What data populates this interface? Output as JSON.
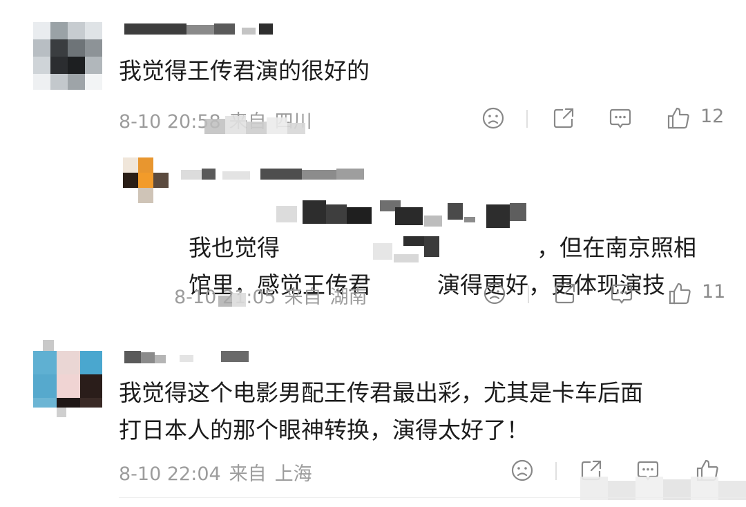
{
  "comments": [
    {
      "content": "我觉得王传君演的很好的",
      "time": "8-10 20:58",
      "from_label": "来自",
      "location": "四川",
      "likes": "12"
    },
    {
      "content_line1": "我也觉得",
      "content_line1_tail": "，但在南京照相",
      "content_line2_a": "馆里，感觉王传君",
      "content_line2_b": "演得更好，更体现演技",
      "time": "8-10 21:05",
      "from_label": "来自",
      "location": "湖南",
      "likes": "11"
    },
    {
      "content": "我觉得这个电影男配王传君最出彩，尤其是卡车后面\n打日本人的那个眼神转换，演得太好了！",
      "time": "8-10 22:04",
      "from_label": "来自",
      "location": "上海",
      "likes": ""
    }
  ],
  "icons": [
    "dislike-icon",
    "share-icon",
    "comment-icon",
    "like-icon"
  ]
}
